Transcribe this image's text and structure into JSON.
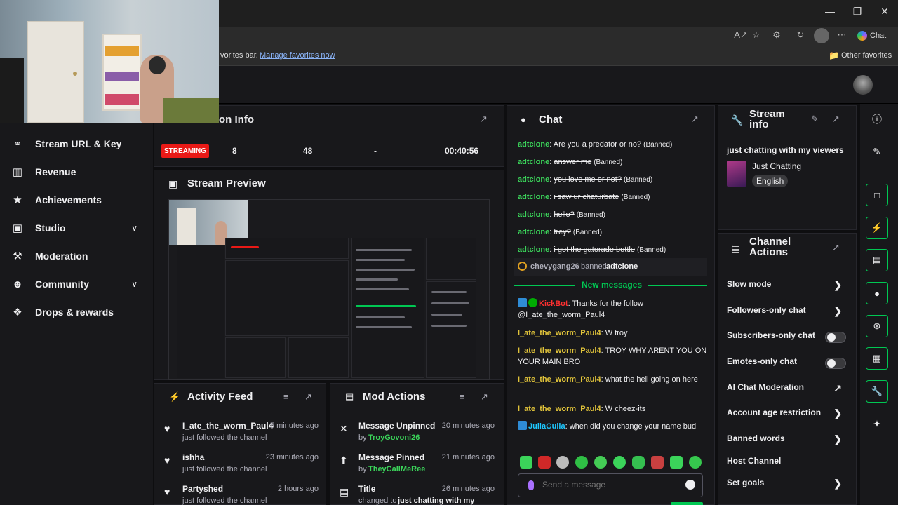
{
  "browser": {
    "favbar_text": "vorites bar.",
    "favbar_link": "Manage favorites now",
    "other_favorites": "Other favorites",
    "chat_button": "Chat"
  },
  "nav": {
    "items": [
      {
        "label": "Stream URL & Key",
        "icon": "link-icon"
      },
      {
        "label": "Revenue",
        "icon": "chart-icon"
      },
      {
        "label": "Achievements",
        "icon": "trophy-icon"
      },
      {
        "label": "Studio",
        "icon": "film-icon",
        "chevron": true
      },
      {
        "label": "Moderation",
        "icon": "wrench-icon"
      },
      {
        "label": "Community",
        "icon": "people-icon",
        "chevron": true
      },
      {
        "label": "Drops & rewards",
        "icon": "gift-icon"
      }
    ]
  },
  "session_info": {
    "title": "on Info",
    "status": "STREAMING",
    "viewers": "8",
    "followers": "48",
    "subs": "-",
    "duration": "00:40:56"
  },
  "stream_preview": {
    "title": "Stream Preview"
  },
  "activity_feed": {
    "title": "Activity Feed",
    "items": [
      {
        "name": "I_ate_the_worm_Paul4",
        "sub": "just followed the channel",
        "time": "5 minutes ago"
      },
      {
        "name": "ishha",
        "sub": "just followed the channel",
        "time": "23 minutes ago"
      },
      {
        "name": "Partyshed",
        "sub": "just followed the channel",
        "time": "2 hours ago"
      }
    ]
  },
  "mod_actions": {
    "title": "Mod Actions",
    "items": [
      {
        "action": "Message Unpinned",
        "by_prefix": "by",
        "by": "TroyGovoni26",
        "time": "20 minutes ago"
      },
      {
        "action": "Message Pinned",
        "by_prefix": "by",
        "by": "TheyCallMeRee",
        "time": "21 minutes ago"
      },
      {
        "action": "Title",
        "by_prefix": "changed to",
        "by": "just chatting with my",
        "time": "26 minutes ago"
      }
    ]
  },
  "chat": {
    "title": "Chat",
    "banned_messages": [
      {
        "user": "adtclone",
        "text": "Are you a predator or no?",
        "tag": "(Banned)"
      },
      {
        "user": "adtclone",
        "text": "answer me",
        "tag": "(Banned)"
      },
      {
        "user": "adtclone",
        "text": "you love me or not?",
        "tag": "(Banned)"
      },
      {
        "user": "adtclone",
        "text": "i saw ur chaturbate",
        "tag": "(Banned)"
      },
      {
        "user": "adtclone",
        "text": "hello?",
        "tag": "(Banned)"
      },
      {
        "user": "adtclone",
        "text": "trey?",
        "tag": "(Banned)"
      },
      {
        "user": "adtclone",
        "text": "i got the gatorade bottle",
        "tag": "(Banned)"
      }
    ],
    "ban_notice": {
      "mod": "chevygang26",
      "verb": "banned",
      "target": "adtclone"
    },
    "new_messages_label": "New messages",
    "messages": [
      {
        "user": "KickBot",
        "text": "Thanks for the follow @I_ate_the_worm_Paul4"
      },
      {
        "user": "I_ate_the_worm_Paul4",
        "text": "W troy"
      },
      {
        "user": "I_ate_the_worm_Paul4",
        "text": "TROY WHY ARENT YOU ON YOUR MAIN BRO"
      },
      {
        "user": "I_ate_the_worm_Paul4",
        "text": "what the hell going on here"
      },
      {
        "user": "I_ate_the_worm_Paul4",
        "text": "W cheez-its"
      },
      {
        "user": "JuliaGulia",
        "text": "when did you change your name bud"
      }
    ],
    "input_placeholder": "Send a message"
  },
  "stream_info": {
    "title": "Stream info",
    "stream_title": "just chatting with my viewers",
    "category": "Just Chatting",
    "language": "English"
  },
  "channel_actions": {
    "title": "Channel Actions",
    "items": [
      {
        "label": "Slow mode",
        "control": "chevron"
      },
      {
        "label": "Followers-only chat",
        "control": "chevron"
      },
      {
        "label": "Subscribers-only chat",
        "control": "toggle"
      },
      {
        "label": "Emotes-only chat",
        "control": "toggle"
      },
      {
        "label": "AI Chat Moderation",
        "control": "external"
      },
      {
        "label": "Account age restriction",
        "control": "chevron"
      },
      {
        "label": "Banned words",
        "control": "chevron"
      },
      {
        "label": "Host Channel",
        "control": "none"
      },
      {
        "label": "Set goals",
        "control": "chevron"
      }
    ]
  },
  "colors": {
    "accent_green": "#00c853",
    "streaming_red": "#e91916",
    "panel_bg": "#18181b",
    "page_bg": "#0e0e10"
  }
}
